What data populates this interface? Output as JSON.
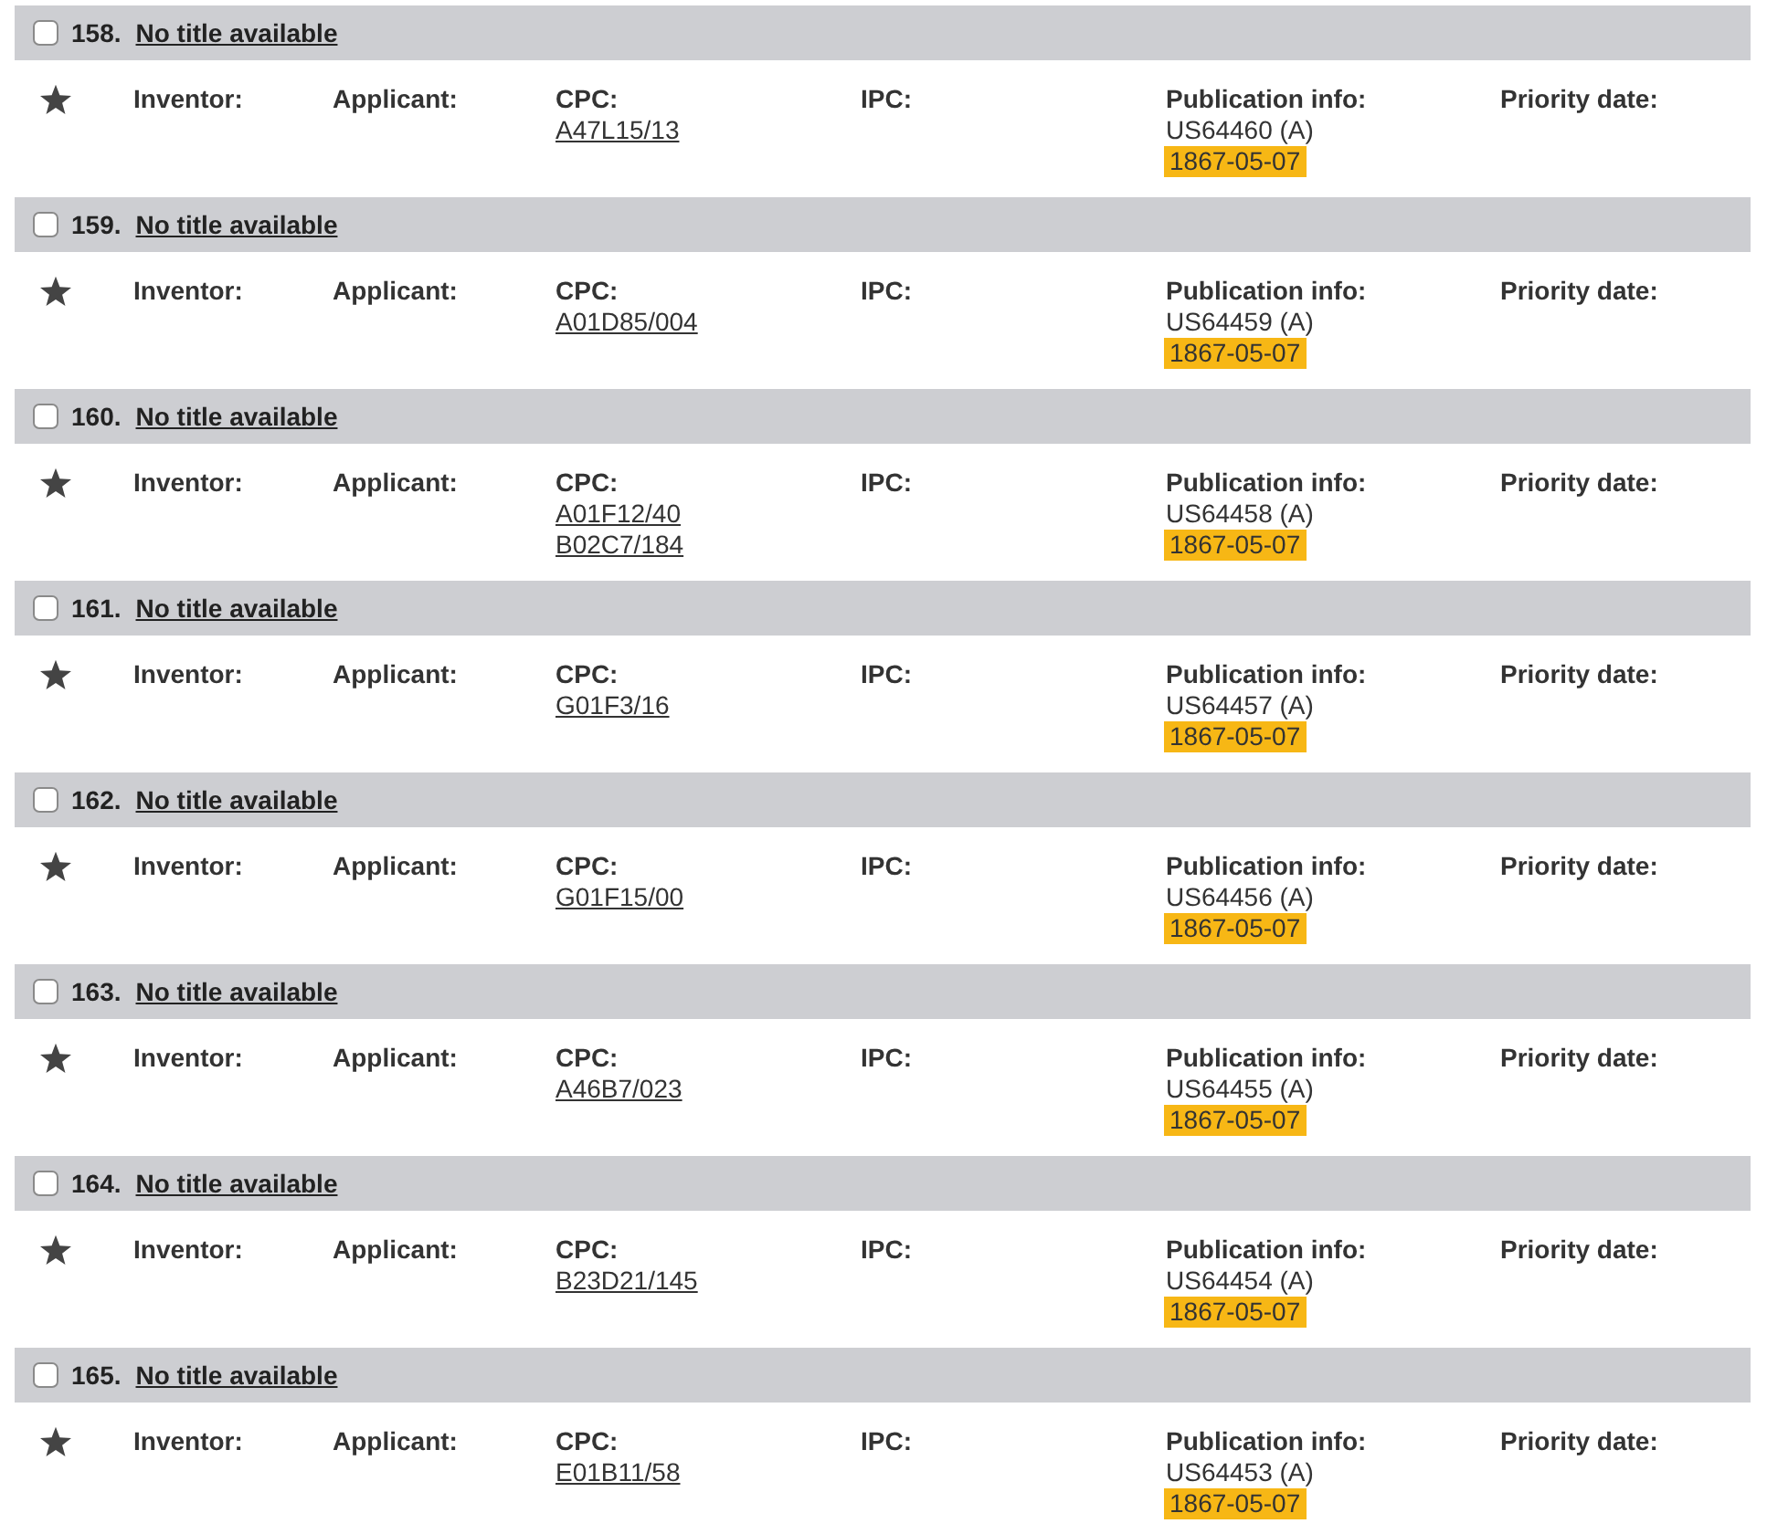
{
  "results": [
    {
      "number": "158.",
      "title": "No title available",
      "checked": false,
      "fields": [
        {
          "label": "Inventor:"
        },
        {
          "label": "Applicant:"
        },
        {
          "label": "CPC:",
          "links": [
            "A47L15/13"
          ]
        },
        {
          "label": "IPC:"
        },
        {
          "label": "Publication info:",
          "lines": [
            "US64460 (A)"
          ],
          "date": "1867-05-07"
        },
        {
          "label": "Priority date:"
        }
      ]
    },
    {
      "number": "159.",
      "title": "No title available",
      "checked": false,
      "fields": [
        {
          "label": "Inventor:"
        },
        {
          "label": "Applicant:"
        },
        {
          "label": "CPC:",
          "links": [
            "A01D85/004"
          ]
        },
        {
          "label": "IPC:"
        },
        {
          "label": "Publication info:",
          "lines": [
            "US64459 (A)"
          ],
          "date": "1867-05-07"
        },
        {
          "label": "Priority date:"
        }
      ]
    },
    {
      "number": "160.",
      "title": "No title available",
      "checked": false,
      "fields": [
        {
          "label": "Inventor:"
        },
        {
          "label": "Applicant:"
        },
        {
          "label": "CPC:",
          "links": [
            "A01F12/40",
            "B02C7/184"
          ]
        },
        {
          "label": "IPC:"
        },
        {
          "label": "Publication info:",
          "lines": [
            "US64458 (A)"
          ],
          "date": "1867-05-07"
        },
        {
          "label": "Priority date:"
        }
      ]
    },
    {
      "number": "161.",
      "title": "No title available",
      "checked": false,
      "fields": [
        {
          "label": "Inventor:"
        },
        {
          "label": "Applicant:"
        },
        {
          "label": "CPC:",
          "links": [
            "G01F3/16"
          ]
        },
        {
          "label": "IPC:"
        },
        {
          "label": "Publication info:",
          "lines": [
            "US64457 (A)"
          ],
          "date": "1867-05-07"
        },
        {
          "label": "Priority date:"
        }
      ]
    },
    {
      "number": "162.",
      "title": "No title available",
      "checked": false,
      "fields": [
        {
          "label": "Inventor:"
        },
        {
          "label": "Applicant:"
        },
        {
          "label": "CPC:",
          "links": [
            "G01F15/00"
          ]
        },
        {
          "label": "IPC:"
        },
        {
          "label": "Publication info:",
          "lines": [
            "US64456 (A)"
          ],
          "date": "1867-05-07"
        },
        {
          "label": "Priority date:"
        }
      ]
    },
    {
      "number": "163.",
      "title": "No title available",
      "checked": false,
      "fields": [
        {
          "label": "Inventor:"
        },
        {
          "label": "Applicant:"
        },
        {
          "label": "CPC:",
          "links": [
            "A46B7/023"
          ]
        },
        {
          "label": "IPC:"
        },
        {
          "label": "Publication info:",
          "lines": [
            "US64455 (A)"
          ],
          "date": "1867-05-07"
        },
        {
          "label": "Priority date:"
        }
      ]
    },
    {
      "number": "164.",
      "title": "No title available",
      "checked": false,
      "fields": [
        {
          "label": "Inventor:"
        },
        {
          "label": "Applicant:"
        },
        {
          "label": "CPC:",
          "links": [
            "B23D21/145"
          ]
        },
        {
          "label": "IPC:"
        },
        {
          "label": "Publication info:",
          "lines": [
            "US64454 (A)"
          ],
          "date": "1867-05-07"
        },
        {
          "label": "Priority date:"
        }
      ]
    },
    {
      "number": "165.",
      "title": "No title available",
      "checked": false,
      "fields": [
        {
          "label": "Inventor:"
        },
        {
          "label": "Applicant:"
        },
        {
          "label": "CPC:",
          "links": [
            "E01B11/58"
          ]
        },
        {
          "label": "IPC:"
        },
        {
          "label": "Publication info:",
          "lines": [
            "US64453 (A)"
          ],
          "date": "1867-05-07"
        },
        {
          "label": "Priority date:"
        }
      ]
    }
  ]
}
